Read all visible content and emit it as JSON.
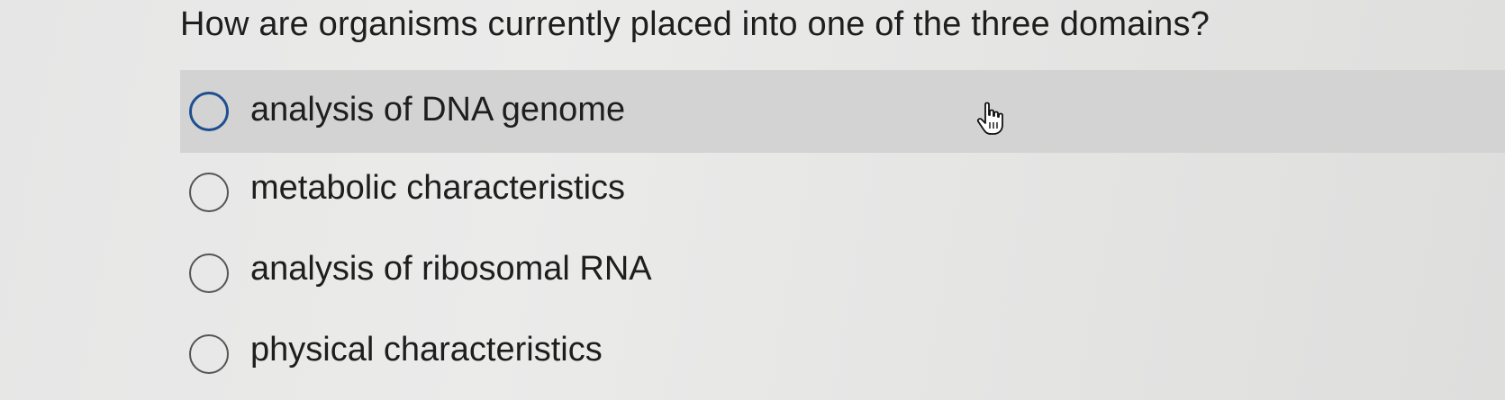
{
  "question": {
    "text": "How are organisms currently placed into one of the three domains?"
  },
  "options": [
    {
      "label": "analysis of DNA genome",
      "selected": false
    },
    {
      "label": "metabolic characteristics",
      "selected": false
    },
    {
      "label": "analysis of ribosomal RNA",
      "selected": false
    },
    {
      "label": "physical characteristics",
      "selected": false
    }
  ],
  "cursor": {
    "icon": "hand-pointer-icon"
  },
  "colors": {
    "hover_row": "#d3d3d3",
    "radio_focus": "#1f4f8f",
    "text": "#1e1e1e"
  }
}
